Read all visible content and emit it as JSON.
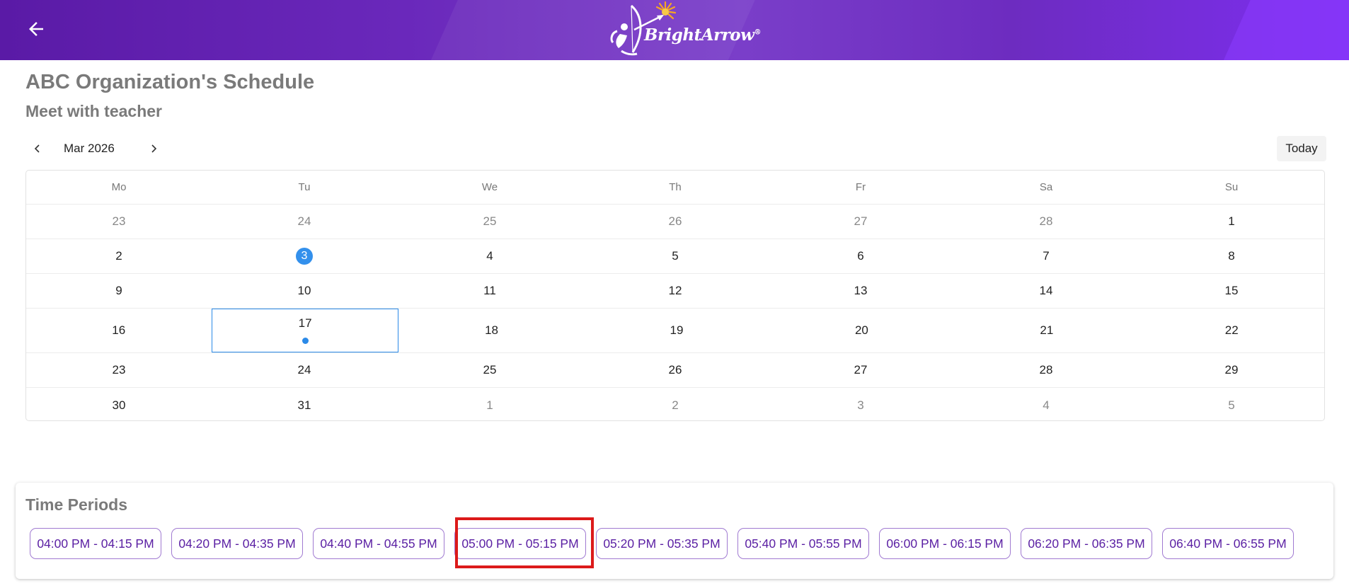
{
  "header": {
    "back_icon": "arrow-left-icon",
    "logo_text": "BrightArrow",
    "logo_mark": "®",
    "colors": {
      "primary": "#6a28bb",
      "accent": "#7d2ef0"
    }
  },
  "page": {
    "title": "ABC Organization's Schedule",
    "subtitle": "Meet with teacher"
  },
  "calendar": {
    "month_label": "Mar 2026",
    "prev_icon": "chevron-left-icon",
    "next_icon": "chevron-right-icon",
    "today_label": "Today",
    "weekdays": [
      "Mo",
      "Tu",
      "We",
      "Th",
      "Fr",
      "Sa",
      "Su"
    ],
    "weeks": [
      [
        "23",
        "24",
        "25",
        "26",
        "27",
        "28",
        "1"
      ],
      [
        "2",
        "3",
        "4",
        "5",
        "6",
        "7",
        "8"
      ],
      [
        "9",
        "10",
        "11",
        "12",
        "13",
        "14",
        "15"
      ],
      [
        "16",
        "17",
        "18",
        "19",
        "20",
        "21",
        "22"
      ],
      [
        "23",
        "24",
        "25",
        "26",
        "27",
        "28",
        "29"
      ],
      [
        "30",
        "31",
        "1",
        "2",
        "3",
        "4",
        "5"
      ]
    ],
    "today_date": "3",
    "selected_date": "17",
    "event_dates": [
      "17"
    ],
    "colors": {
      "today": "#3390ec",
      "selected_border": "#2b8ae8"
    }
  },
  "time_periods": {
    "title": "Time Periods",
    "slots": [
      "04:00 PM - 04:15 PM",
      "04:20 PM - 04:35 PM",
      "04:40 PM - 04:55 PM",
      "05:00 PM - 05:15 PM",
      "05:20 PM - 05:35 PM",
      "05:40 PM - 05:55 PM",
      "06:00 PM - 06:15 PM",
      "06:20 PM - 06:35 PM",
      "06:40 PM - 06:55 PM"
    ],
    "highlighted_slot": "05:00 PM - 05:15 PM",
    "colors": {
      "slot_text": "#5a1fa3",
      "slot_border": "#a07ad1",
      "highlight": "#dc1a1a"
    }
  }
}
